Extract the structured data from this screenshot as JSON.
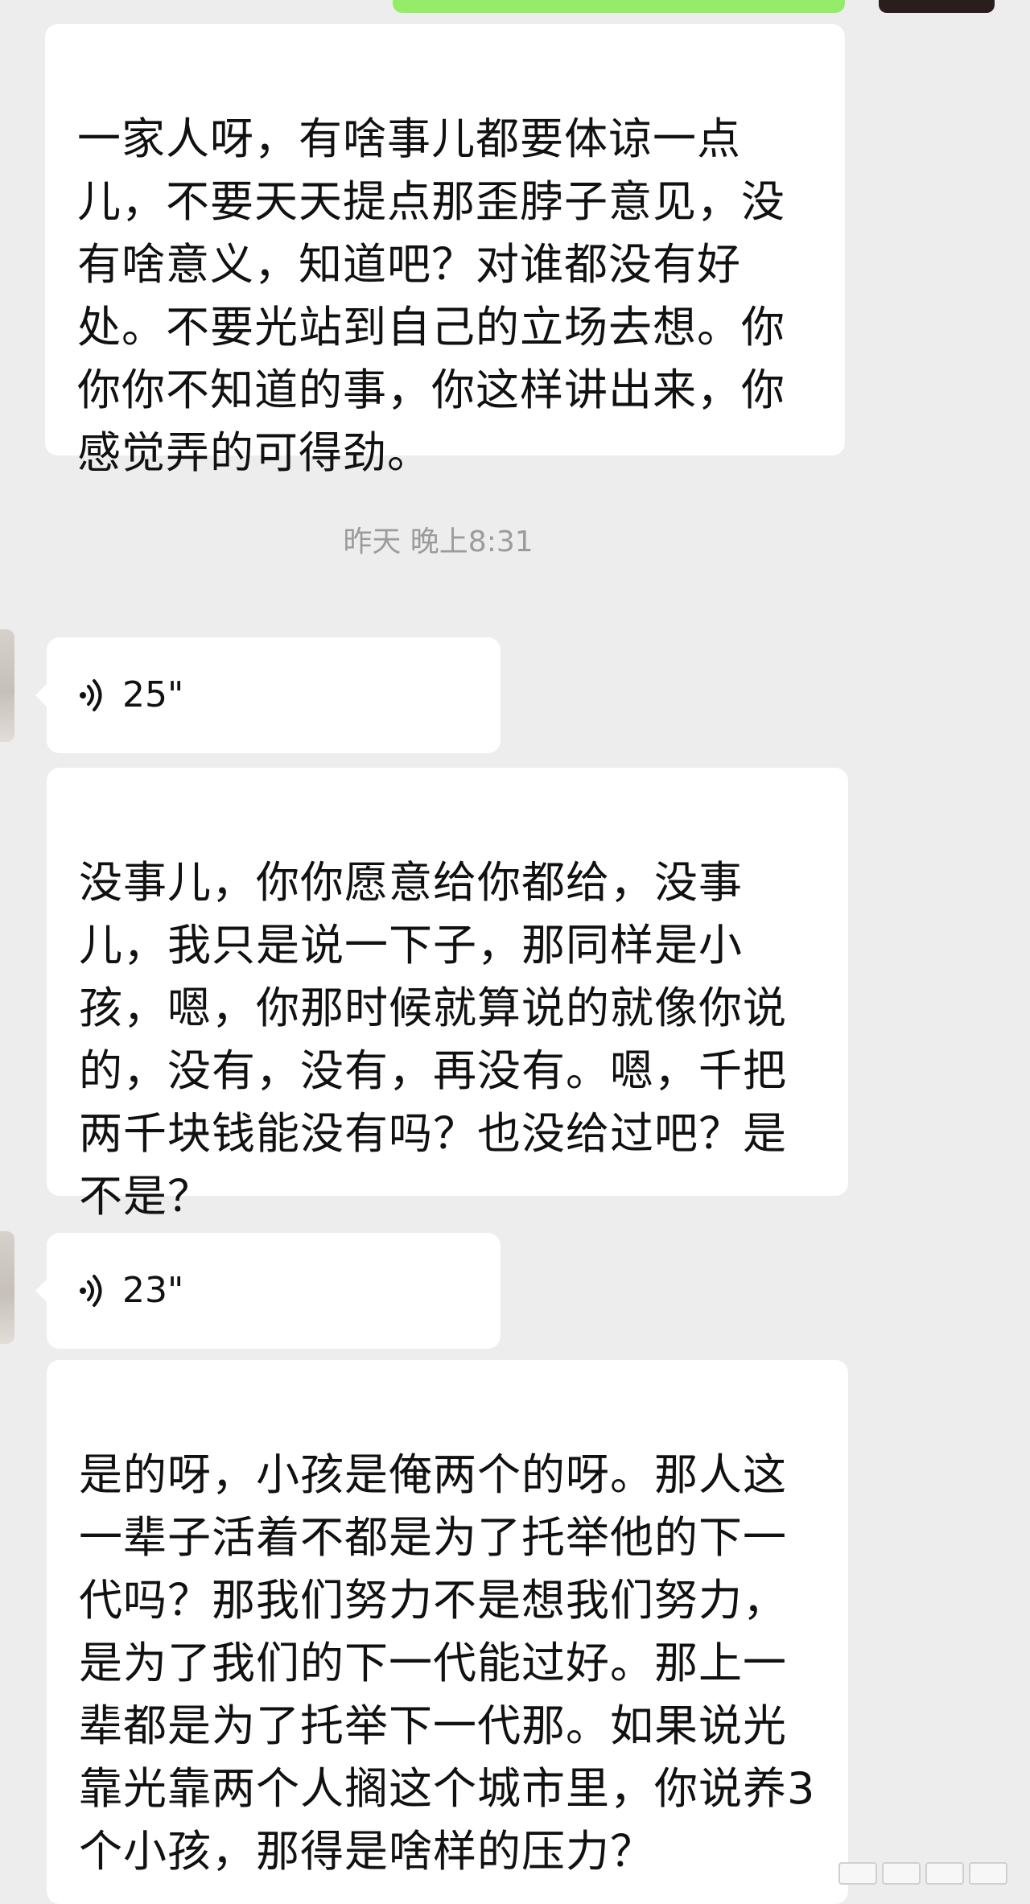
{
  "messages": {
    "msg1_text": "一家人呀，有啥事儿都要体谅一点儿，不要天天提点那歪脖子意见，没有啥意义，知道吧？对谁都没有好处。不要光站到自己的立场去想。你你你不知道的事，你这样讲出来，你感觉弄的可得劲。",
    "timestamp": "昨天 晚上8:31",
    "voice1_duration": "25\"",
    "msg2_text": "没事儿，你你愿意给你都给，没事儿，我只是说一下子，那同样是小孩，嗯，你那时候就算说的就像你说的，没有，没有，再没有。嗯，千把两千块钱能没有吗？也没给过吧？是不是？",
    "voice2_duration": "23\"",
    "msg3_text": "是的呀，小孩是俺两个的呀。那人这一辈子活着不都是为了托举他的下一代吗？那我们努力不是想我们努力，是为了我们的下一代能过好。那上一辈都是为了托举下一代那。如果说光靠光靠两个人搁这个城市里，你说养3个小孩，那得是啥样的压力？"
  },
  "icons": {
    "voice": "voice-wave-icon",
    "watermark": "watermark-icon"
  },
  "colors": {
    "background": "#ededed",
    "bubble": "#ffffff",
    "sent_bubble": "#95ec69",
    "timestamp": "#9b9b9b"
  }
}
